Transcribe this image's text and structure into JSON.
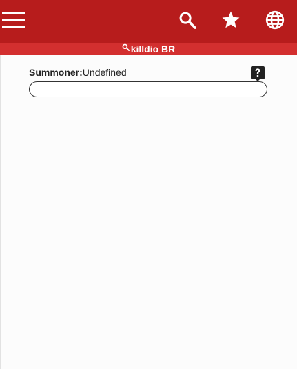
{
  "header": {
    "menu_icon": "hamburger-menu-icon",
    "search_icon": "search-icon",
    "favorites_icon": "star-icon",
    "language_icon": "globe-icon",
    "background": "#b71c1c"
  },
  "subheader": {
    "icon": "search-icon",
    "text": "killdio BR",
    "background": "#d32f2f"
  },
  "form": {
    "summoner_label": "Summoner:",
    "summoner_value": "Undefined",
    "help_icon": "help-question-icon",
    "input_value": "",
    "input_placeholder": ""
  }
}
